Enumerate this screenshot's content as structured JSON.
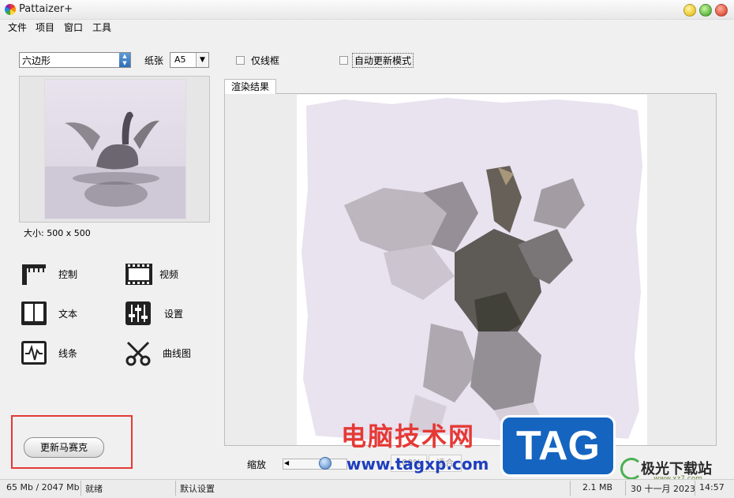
{
  "window": {
    "title": "Pattaizer+"
  },
  "menu": [
    "文件",
    "项目",
    "窗口",
    "工具"
  ],
  "toolbar": {
    "shape_select": "六边形",
    "paper_label": "纸张",
    "paper_value": "A5",
    "wireframe_label": "仅线框",
    "wireframe_checked": false,
    "auto_update_label": "自动更新模式",
    "auto_update_checked": false
  },
  "preview": {
    "size_label": "大小: 500 x 500"
  },
  "tools": [
    {
      "label": "控制",
      "icon": "ruler-clamp-icon"
    },
    {
      "label": "视频",
      "icon": "film-strip-icon"
    },
    {
      "label": "文本",
      "icon": "book-icon"
    },
    {
      "label": "设置",
      "icon": "sliders-icon"
    },
    {
      "label": "线条",
      "icon": "waveform-icon"
    },
    {
      "label": "曲线图",
      "icon": "scissors-icon"
    }
  ],
  "update_button": "更新马赛克",
  "render": {
    "tab_label": "渲染结果"
  },
  "zoom": {
    "label": "缩放",
    "value_text": "100%",
    "fit_label": "适合"
  },
  "status": {
    "memory": "65 Mb / 2047 Mb",
    "state": "就绪",
    "preset": "默认设置",
    "file_size": "2.1 MB",
    "date": "30 十一月 2023",
    "time": "14:57"
  },
  "watermark": {
    "text": "电脑技术网",
    "url": "www.tagxp.com",
    "tag": "TAG",
    "site": "极光下载站",
    "site_url": "www.xz7.com"
  },
  "colors": {
    "highlight_box": "#e53935",
    "accent": "#1565c0"
  }
}
